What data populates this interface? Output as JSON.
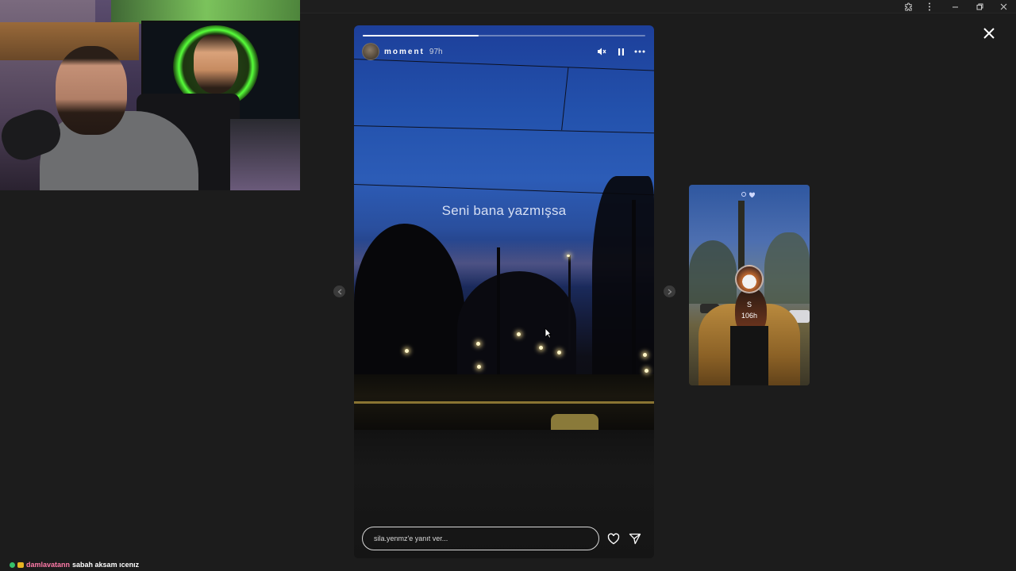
{
  "story": {
    "username": "moment",
    "timestamp": "97h",
    "caption": "Seni bana yazmışsa",
    "progress": 0.41,
    "reply_placeholder": "sila.yenmz'e yanıt ver..."
  },
  "next_story": {
    "username": "S",
    "timestamp": "106h"
  },
  "chat": {
    "username": "damlavatann",
    "message": "sabah aksam ıcenız"
  },
  "icons": {
    "mute": "speaker-muted-icon",
    "pause": "pause-icon",
    "more": "more-horizontal-icon",
    "like": "heart-icon",
    "share": "send-icon",
    "close": "close-icon",
    "prev": "chevron-left-icon",
    "next": "chevron-right-icon"
  },
  "colors": {
    "background": "#1c1c1c",
    "chat_username": "#ff7aa8",
    "webcam_glow": "#57ff3a"
  }
}
